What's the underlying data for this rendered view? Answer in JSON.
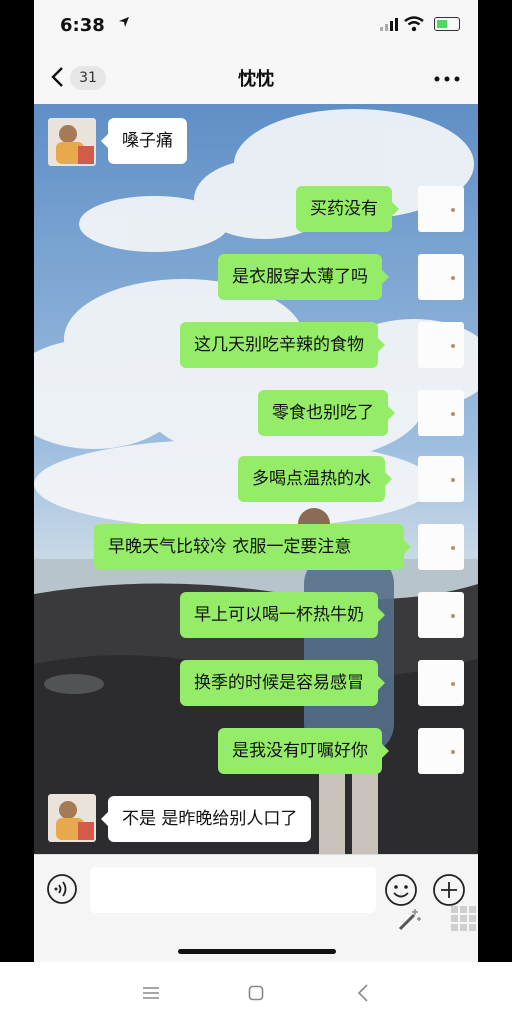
{
  "status_bar": {
    "time": "6:38"
  },
  "header": {
    "back_count": "31",
    "title": "忱忱"
  },
  "messages": [
    {
      "side": "in",
      "text": "嗓子痛"
    },
    {
      "side": "out",
      "text": "买药没有"
    },
    {
      "side": "out",
      "text": "是衣服穿太薄了吗"
    },
    {
      "side": "out",
      "text": "这几天别吃辛辣的食物"
    },
    {
      "side": "out",
      "text": "零食也别吃了"
    },
    {
      "side": "out",
      "text": "多喝点温热的水"
    },
    {
      "side": "out",
      "text": "早晚天气比较冷  衣服一定要注意"
    },
    {
      "side": "out",
      "text": "早上可以喝一杯热牛奶"
    },
    {
      "side": "out",
      "text": "换季的时候是容易感冒"
    },
    {
      "side": "out",
      "text": "是我没有叮嘱好你"
    },
    {
      "side": "in",
      "text": "不是 是昨晚给别人口了"
    }
  ],
  "input": {
    "value": ""
  },
  "colors": {
    "outgoing_bubble": "#95ec69",
    "incoming_bubble": "#ffffff"
  },
  "icons": [
    "location-arrow-icon",
    "signal-icon",
    "wifi-icon",
    "battery-icon",
    "back-chevron-icon",
    "more-icon",
    "voice-icon",
    "emoji-icon",
    "plus-icon",
    "magic-wand-icon",
    "grid-icon",
    "menu-icon",
    "home-icon",
    "back-icon"
  ]
}
